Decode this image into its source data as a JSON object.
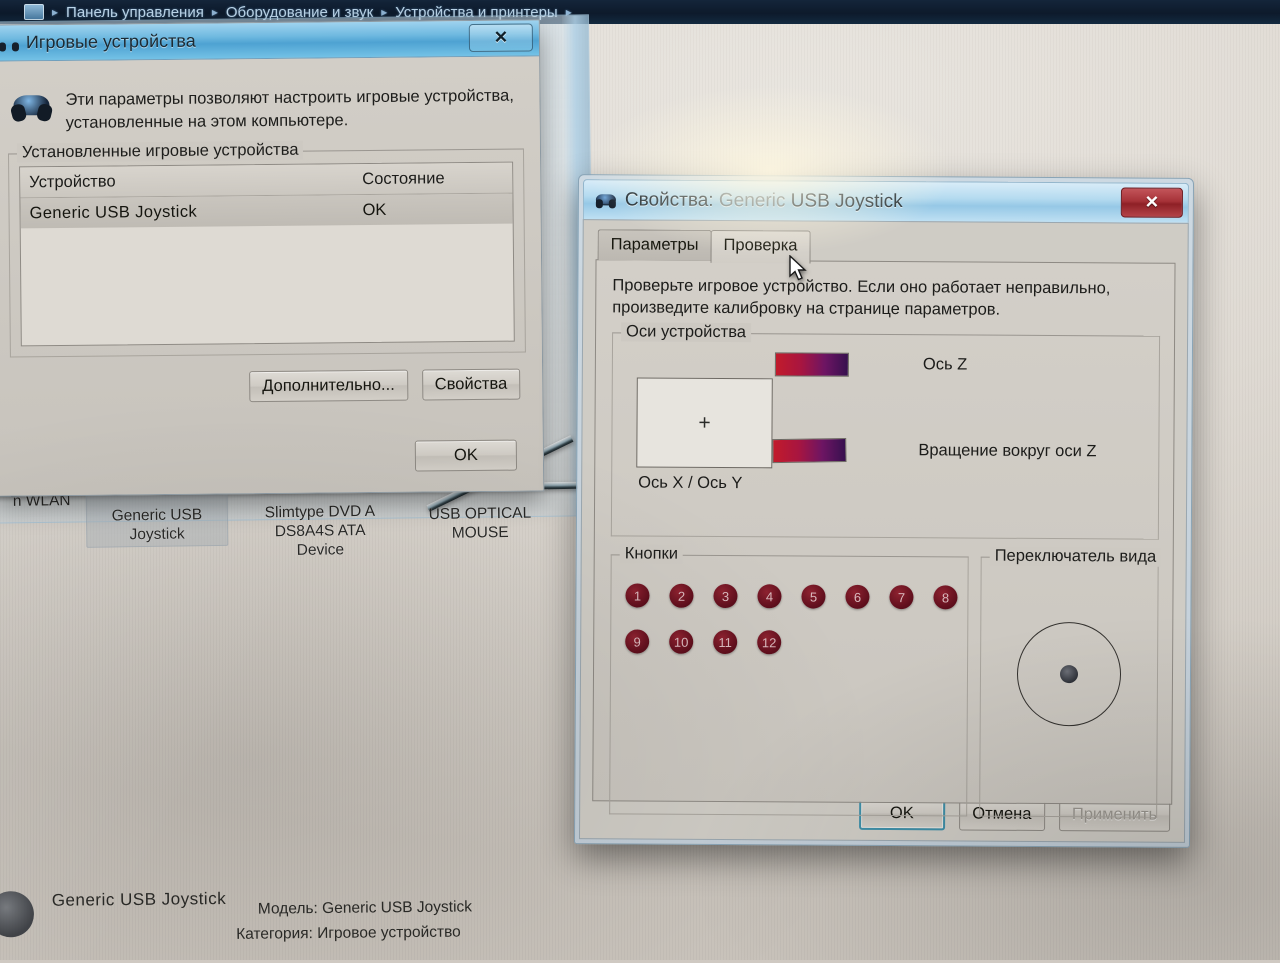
{
  "breadcrumb": {
    "icon": "control-panel-icon",
    "items": [
      {
        "label": "Панель управления"
      },
      {
        "label": "Оборудование и звук"
      },
      {
        "label": "Устройства и принтеры"
      }
    ],
    "separator": "▸"
  },
  "devices_window": {
    "device_tiles": [
      {
        "label": "n WLAN",
        "selected": false
      },
      {
        "label": "Generic  USB\nJoystick",
        "selected": true
      },
      {
        "label": "Slimtype DVD A\nDS8A4S ATA\nDevice",
        "selected": false
      },
      {
        "label": "USB OPTICAL\nMOUSE",
        "selected": false
      }
    ],
    "details": {
      "title": "Generic  USB  Joystick",
      "model": "Модель: Generic  USB  Joystick",
      "category": "Категория: Игровое устройство"
    }
  },
  "game_controllers_dialog": {
    "title": "Игровые устройства",
    "close_label": "✕",
    "intro": "Эти параметры позволяют настроить игровые устройства, установленные на этом компьютере.",
    "group_title": "Установленные игровые устройства",
    "table": {
      "columns": [
        "Устройство",
        "Состояние"
      ],
      "rows": [
        {
          "device": "Generic  USB  Joystick",
          "status": "OK"
        }
      ]
    },
    "buttons": {
      "advanced": "Дополнительно...",
      "properties": "Свойства",
      "ok": "OK"
    }
  },
  "properties_dialog": {
    "title_prefix": "Свойства:",
    "title_device": "Generic",
    "title_device_rest": "USB  Joystick",
    "close_label": "✕",
    "tabs": [
      {
        "label": "Параметры",
        "active": false
      },
      {
        "label": "Проверка",
        "active": true
      }
    ],
    "hint": "Проверьте игровое устройство. Если оно работает неправильно, произведите калибровку на странице параметров.",
    "axes": {
      "group_title": "Оси устройства",
      "xy_label": "Ось X / Ось Y",
      "xy_marker": "+",
      "bars": [
        {
          "label": "Ось Z",
          "gradient_from": "#c21b2b",
          "gradient_to": "#37104f"
        },
        {
          "label": "Вращение вокруг оси Z",
          "gradient_from": "#c21b2b",
          "gradient_to": "#37104f"
        }
      ]
    },
    "buttons_group": {
      "title": "Кнопки",
      "rows": [
        [
          "1",
          "2",
          "3",
          "4",
          "5",
          "6",
          "7",
          "8"
        ],
        [
          "9",
          "10",
          "11",
          "12"
        ]
      ],
      "color": "#5e0e1c"
    },
    "pov": {
      "title": "Переключатель вида"
    },
    "footer": {
      "ok": "OK",
      "cancel": "Отмена",
      "apply": "Применить",
      "apply_disabled": true
    }
  }
}
